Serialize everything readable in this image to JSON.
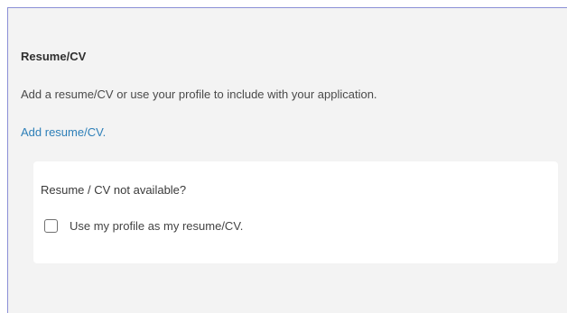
{
  "resume_section": {
    "title": "Resume/CV",
    "description": "Add a resume/CV or use your profile to include with your application.",
    "add_link": "Add resume/CV."
  },
  "not_available_card": {
    "heading": "Resume / CV not available?",
    "checkbox": {
      "label": "Use my profile as my resume/CV.",
      "checked": false
    }
  }
}
